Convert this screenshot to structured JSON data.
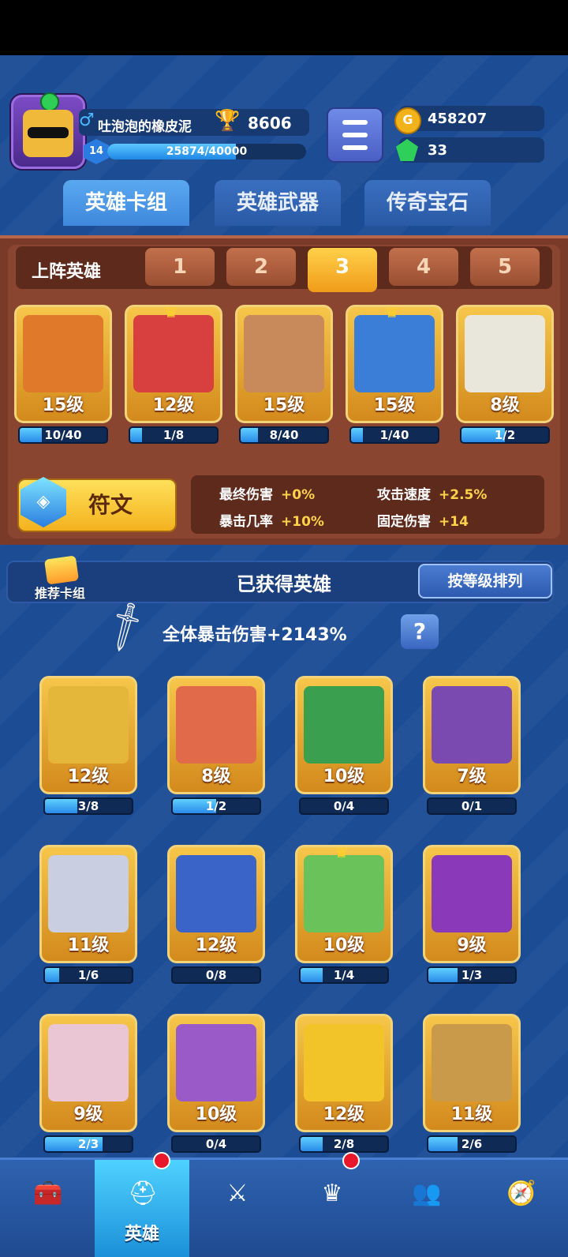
{
  "player": {
    "name": "吐泡泡的橡皮泥",
    "gender_icon": "♂",
    "trophies": "8606",
    "level": "14",
    "xp": "25874/40000",
    "xp_fraction": 0.647
  },
  "currency": {
    "gold": "458207",
    "gems": "33"
  },
  "tabs": [
    "英雄卡组",
    "英雄武器",
    "传奇宝石"
  ],
  "lineup": {
    "label": "上阵英雄",
    "slots": [
      "1",
      "2",
      "3",
      "4",
      "5"
    ],
    "active_slot": 3,
    "heroes": [
      {
        "level": "15级",
        "progress": "10/40",
        "fraction": 0.25,
        "color": "#e07a2a",
        "crown": false
      },
      {
        "level": "12级",
        "progress": "1/8",
        "fraction": 0.125,
        "color": "#d84040",
        "crown": true
      },
      {
        "level": "15级",
        "progress": "8/40",
        "fraction": 0.2,
        "color": "#c88a5a",
        "crown": false
      },
      {
        "level": "15级",
        "progress": "1/40",
        "fraction": 0.025,
        "color": "#3a7ed8",
        "crown": true
      },
      {
        "level": "8级",
        "progress": "1/2",
        "fraction": 0.5,
        "color": "#e9e6dc",
        "crown": false
      }
    ]
  },
  "rune": {
    "label": "符文",
    "icon": "rune-crystal-icon"
  },
  "stats": [
    {
      "name": "最终伤害",
      "value": "+0%"
    },
    {
      "name": "攻击速度",
      "value": "+2.5%"
    },
    {
      "name": "暴击几率",
      "value": "+10%"
    },
    {
      "name": "固定伤害",
      "value": "+14"
    }
  ],
  "owned": {
    "deck_label": "推荐卡组",
    "title": "已获得英雄",
    "sort_label": "按等级排列",
    "bonus": "全体暴击伤害+2143%",
    "help": "?",
    "heroes": [
      {
        "level": "12级",
        "progress": "3/8",
        "fraction": 0.375,
        "color": "#e4b63a",
        "crown": false
      },
      {
        "level": "8级",
        "progress": "1/2",
        "fraction": 0.5,
        "color": "#e06a4a",
        "crown": false
      },
      {
        "level": "10级",
        "progress": "0/4",
        "fraction": 0,
        "color": "#3aa050",
        "crown": false
      },
      {
        "level": "7级",
        "progress": "0/1",
        "fraction": 0,
        "color": "#7a4ab0",
        "crown": false
      },
      {
        "level": "11级",
        "progress": "1/6",
        "fraction": 0.167,
        "color": "#c9cfe0",
        "crown": false
      },
      {
        "level": "12级",
        "progress": "0/8",
        "fraction": 0,
        "color": "#3a64c8",
        "crown": false
      },
      {
        "level": "10级",
        "progress": "1/4",
        "fraction": 0.25,
        "color": "#6ac25a",
        "crown": true
      },
      {
        "level": "9级",
        "progress": "1/3",
        "fraction": 0.333,
        "color": "#8a3ab8",
        "crown": false
      },
      {
        "level": "9级",
        "progress": "2/3",
        "fraction": 0.667,
        "color": "#eac6d4",
        "crown": false
      },
      {
        "level": "10级",
        "progress": "0/4",
        "fraction": 0,
        "color": "#9a5ac8",
        "crown": false
      },
      {
        "level": "12级",
        "progress": "2/8",
        "fraction": 0.25,
        "color": "#f2c42a",
        "crown": false
      },
      {
        "level": "11级",
        "progress": "2/6",
        "fraction": 0.333,
        "color": "#c89a4a",
        "crown": false
      }
    ]
  },
  "nav": [
    {
      "icon": "treasure-chest-icon",
      "label": "",
      "active": false,
      "badge": false
    },
    {
      "icon": "knight-helmet-icon",
      "label": "英雄",
      "active": true,
      "badge": true
    },
    {
      "icon": "crossed-swords-icon",
      "label": "",
      "active": false,
      "badge": false
    },
    {
      "icon": "crown-shield-icon",
      "label": "",
      "active": false,
      "badge": true
    },
    {
      "icon": "group-icon",
      "label": "",
      "active": false,
      "badge": false
    },
    {
      "icon": "compass-icon",
      "label": "",
      "active": false,
      "badge": false
    }
  ]
}
